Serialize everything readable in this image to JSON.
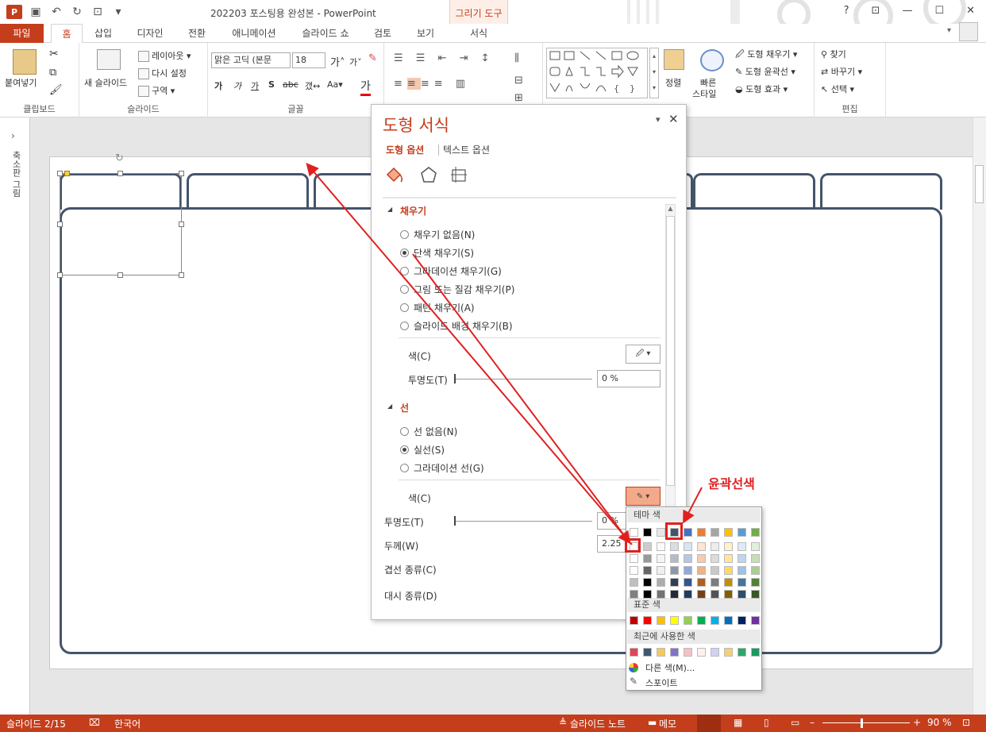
{
  "window": {
    "title": "202203 포스팅용 완성본 - PowerPoint",
    "context_group": "그리기 도구",
    "help": "?"
  },
  "tabs": [
    "파일",
    "홈",
    "삽입",
    "디자인",
    "전환",
    "애니메이션",
    "슬라이드 쇼",
    "검토",
    "보기",
    "서식"
  ],
  "ribbon": {
    "clipboard": {
      "paste": "붙여넣기",
      "label": "클립보드"
    },
    "slides": {
      "new": "새 슬라이드",
      "layout": "레이아웃",
      "reset": "다시 설정",
      "section": "구역",
      "label": "슬라이드"
    },
    "font": {
      "name": "맑은 고딕 (본문",
      "size": "18",
      "label": "글꼴"
    },
    "drawing": {
      "arrange": "정렬",
      "quick": "빠른",
      "quick2": "스타일",
      "fill": "도형 채우기",
      "outline": "도형 윤곽선",
      "effect": "도형 효과"
    },
    "edit": {
      "find": "찾기",
      "replace": "바꾸기",
      "select": "선택",
      "label": "편집"
    }
  },
  "left_panel": {
    "label": "축소판 그림"
  },
  "pane": {
    "title": "도형 서식",
    "tab_shape": "도형 옵션",
    "tab_text": "텍스트 옵션",
    "fill": {
      "header": "채우기",
      "options": [
        "채우기 없음(N)",
        "단색 채우기(S)",
        "그라데이션 채우기(G)",
        "그림 또는 질감 채우기(P)",
        "패턴 채우기(A)",
        "슬라이드 배경 채우기(B)"
      ],
      "selected": 1,
      "color_label": "색(C)",
      "transparency_label": "투명도(T)",
      "transparency": "0 %"
    },
    "line": {
      "header": "선",
      "options": [
        "선 없음(N)",
        "실선(S)",
        "그라데이션 선(G)"
      ],
      "selected": 1,
      "color_label": "색(C)",
      "transparency_label": "투명도(T)",
      "transparency": "0 %",
      "width_label": "두께(W)",
      "width": "2.25",
      "compound_label": "겹선 종류(C)",
      "dash_label": "대시 종류(D)"
    }
  },
  "color_popup": {
    "theme_header": "테마 색",
    "standard_header": "표준 색",
    "recent_header": "최근에 사용한 색",
    "more": "다른 색(M)...",
    "eyedropper": "스포이트",
    "theme_top": [
      "#ffffff",
      "#000000",
      "#e7e6e6",
      "#44546a",
      "#4472c4",
      "#ed7d31",
      "#a5a5a5",
      "#ffc000",
      "#5b9bd5",
      "#70ad47"
    ],
    "standard": [
      "#c00000",
      "#ff0000",
      "#ffc000",
      "#ffff00",
      "#92d050",
      "#00b050",
      "#00b0f0",
      "#0070c0",
      "#002060",
      "#7030a0"
    ],
    "recent": [
      "#e0445a",
      "#3f5871",
      "#f5c959",
      "#8073c8",
      "#f4c1c4",
      "#fdf0ee",
      "#cfd3f0",
      "#f5cf75",
      "#2ea66d",
      "#1a9a60"
    ]
  },
  "annotation": {
    "label": "윤곽선색"
  },
  "status": {
    "slide": "슬라이드 2/15",
    "lang": "한국어",
    "notes": "슬라이드 노트",
    "comments": "메모",
    "zoom": "90 %"
  }
}
